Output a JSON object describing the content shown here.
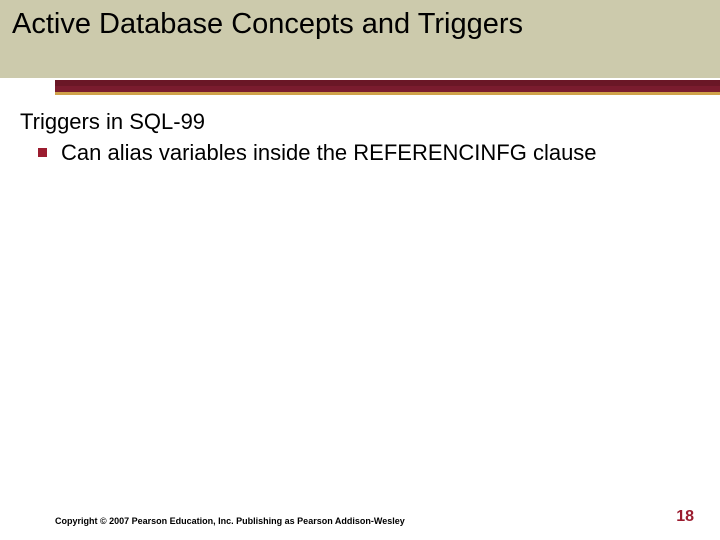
{
  "title": "Active Database Concepts and Triggers",
  "content": {
    "heading": "Triggers in SQL-99",
    "bullets": [
      "Can alias variables inside the REFERENCINFG clause"
    ]
  },
  "footer": {
    "copyright": "Copyright © 2007 Pearson Education, Inc. Publishing as Pearson Addison-Wesley",
    "page": "18"
  }
}
